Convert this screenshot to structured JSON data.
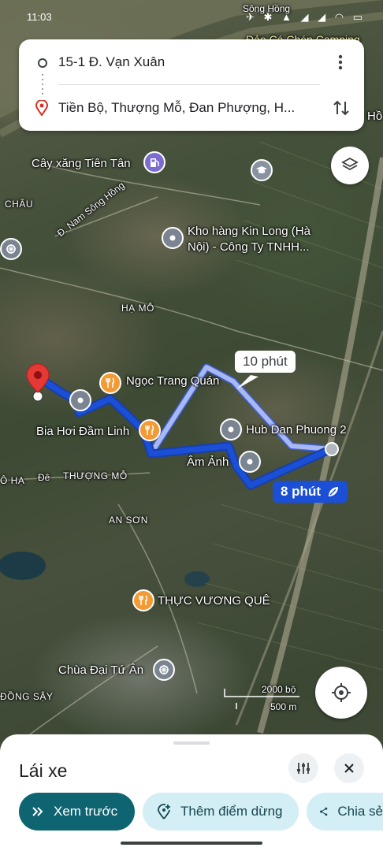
{
  "status_bar": {
    "time": "11:03",
    "icons": "✈ ✱ ▲ ◢ ◢ ◠ ▭"
  },
  "route_card": {
    "origin": "15-1 Đ. Vạn Xuân",
    "destination": "Tiền Bộ, Thượng Mỗ, Đan Phượng, H..."
  },
  "map_labels": {
    "song_hong": "Sông Hồng",
    "camping": "Đảo Cá Chép Camping",
    "ho_edge": "Hồ",
    "gas_station": "Cây xăng Tiên Tân",
    "chau": "CHÂU",
    "nam_song_hong": "Đ. Nam Sông Hồng",
    "kho_hang_1": "Kho hàng Kin Long (Hà",
    "kho_hang_2": "Nội) - Công Ty TNHH...",
    "ha_mo": "HẠ MỖ",
    "ngoc_trang": "Ngọc Trang Quán",
    "bia_hoi": "Bia Hơi Đầm Linh",
    "hub": "Hub Dan Phuong 2",
    "am_anh": "Âm Ảnh",
    "o_ha": "Ô HẠ",
    "de": "Đê",
    "thuong_mo": "THƯỢNG MỖ",
    "an_son": "AN SƠN",
    "thuc_vuong": "THỰC VƯƠNG QUÊ",
    "chua": "Chùa Đại Tứ Ân",
    "dong_say": "ĐỒNG SẬY",
    "scale_ft": "2000 bộ",
    "scale_m": "500 m"
  },
  "route_callouts": {
    "alt": "10 phút",
    "main": "8 phút"
  },
  "bottom_sheet": {
    "title": "Lái xe",
    "preview_label": "Xem trước",
    "add_stop_label": "Thêm điểm dừng",
    "share_label": "Chia sẻ"
  },
  "colors": {
    "route_main": "#1a4fd6",
    "route_alt": "#a9b8f0",
    "primary_chip": "#0f6471",
    "light_chip": "#d3eef4"
  }
}
